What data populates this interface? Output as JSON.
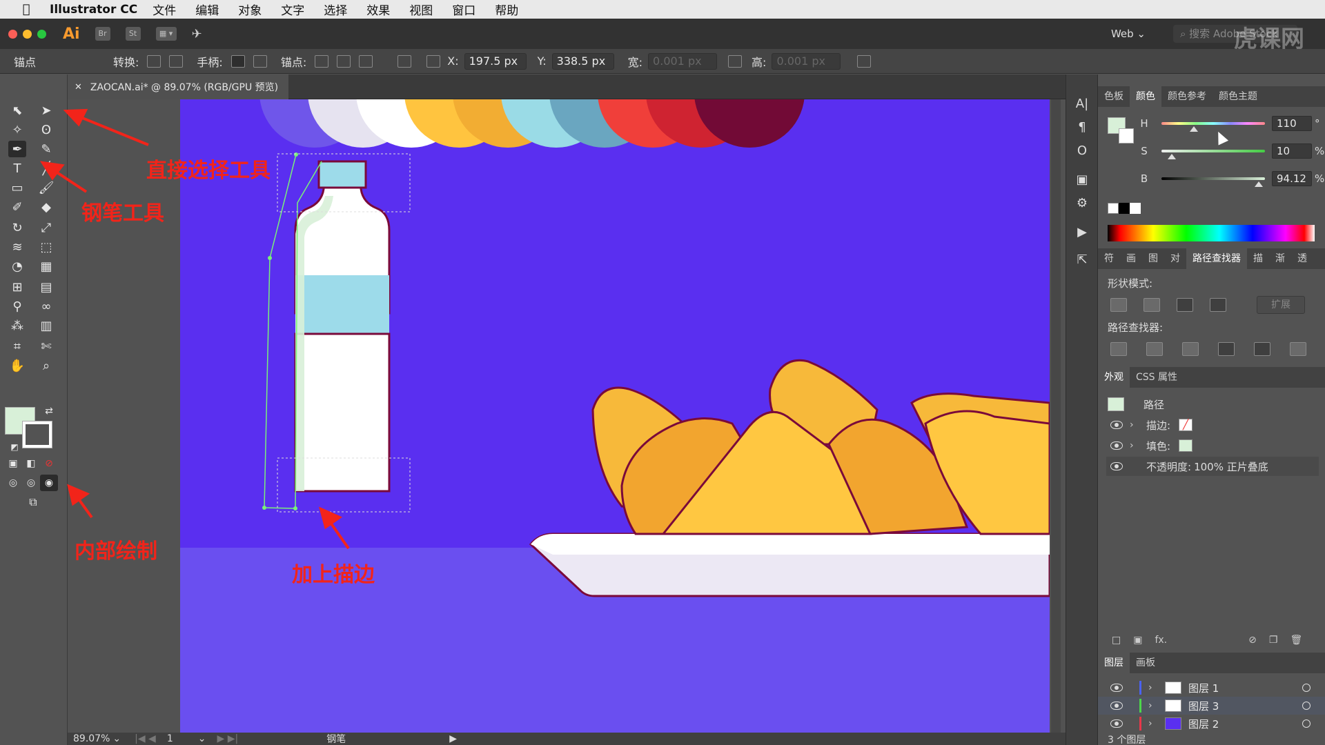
{
  "menubar": {
    "app_name": "Illustrator CC",
    "items": [
      "文件",
      "编辑",
      "对象",
      "文字",
      "选择",
      "效果",
      "视图",
      "窗口",
      "帮助"
    ]
  },
  "appbar": {
    "logo": "Ai",
    "bridge": "Br",
    "stock": "St",
    "workspace": "Web",
    "search_placeholder": "搜索 Adobe Stock",
    "watermark": "虎课网"
  },
  "control": {
    "mode_label": "锚点",
    "convert_label": "转换:",
    "handles_label": "手柄:",
    "anchors_label": "锚点:",
    "x_label": "X:",
    "x_value": "197.5 px",
    "y_label": "Y:",
    "y_value": "338.5 px",
    "w_label": "宽:",
    "w_value": "0.001 px",
    "h_label": "高:",
    "h_value": "0.001 px"
  },
  "document": {
    "tab_title": "ZAOCAN.ai* @ 89.07% (RGB/GPU 预览)",
    "zoom": "89.07%",
    "artboard": "1",
    "tool_status": "钢笔"
  },
  "color_panel": {
    "tabs": [
      "色板",
      "颜色",
      "颜色参考",
      "颜色主题"
    ],
    "active_tab": "颜色",
    "h": {
      "label": "H",
      "value": "110",
      "unit": "°",
      "level": 0.31
    },
    "s": {
      "label": "S",
      "value": "10",
      "unit": "%",
      "level": 0.1
    },
    "b": {
      "label": "B",
      "value": "94.12",
      "unit": "%",
      "level": 0.94
    }
  },
  "pathfinder_panel": {
    "tabs": [
      "符",
      "画",
      "图",
      "对",
      "路径查找器",
      "描",
      "渐",
      "透"
    ],
    "active_tab": "路径查找器",
    "shape_modes": "形状模式:",
    "expand": "扩展",
    "pathfinders": "路径查找器:"
  },
  "appearance_panel": {
    "tabs": [
      "外观",
      "CSS 属性"
    ],
    "title": "路径",
    "stroke_label": "描边:",
    "fill_label": "填色:",
    "opacity_label": "不透明度:",
    "opacity_value": "100% 正片叠底"
  },
  "layers_panel": {
    "tabs": [
      "图层",
      "画板"
    ],
    "layers": [
      {
        "name": "图层 1",
        "color": "#4a62f0"
      },
      {
        "name": "图层 3",
        "color": "#4cd64a"
      },
      {
        "name": "图层 2",
        "color": "#e8384a"
      }
    ],
    "count": "3 个图层"
  },
  "annotations": {
    "direct_select": "直接选择工具",
    "pen_tool": "钢笔工具",
    "draw_inside": "内部绘制",
    "add_stroke": "加上描边"
  },
  "colors": {
    "canvas_bg": "#5a2ff0",
    "fill_swatch": "#d8f0d8",
    "annotation": "#f2241a",
    "ai_orange": "#f89a2e"
  }
}
